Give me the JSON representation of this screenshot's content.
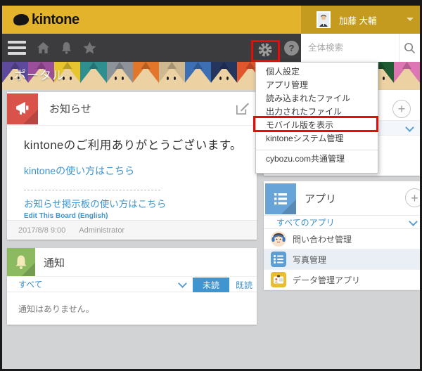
{
  "header": {
    "logo_text": "kintone",
    "user_name": "加藤 大輔"
  },
  "toolbar": {
    "search_placeholder": "全体検索",
    "help_label": "?"
  },
  "banner": {
    "title": "ポータル",
    "pencil_colors": [
      "#5d4a9c",
      "#9b4f9b",
      "#e7c52f",
      "#2f8f8f",
      "#8e9399",
      "#e2762a",
      "#cdb88f",
      "#3d6fb4",
      "#24355e",
      "#e2562e",
      "#b93a93",
      "#cf3434",
      "#e9e4d8",
      "#49a04f",
      "#1f5c33",
      "#df76b4"
    ]
  },
  "gear_menu": {
    "items": [
      "個人設定",
      "アプリ管理",
      "読み込まれたファイル",
      "出力されたファイル",
      "モバイル版を表示",
      "kintoneシステム管理",
      "cybozu.com共通管理"
    ],
    "highlighted_item": "モバイル版を表示"
  },
  "announcement": {
    "title": "お知らせ",
    "greeting": "kintoneのご利用ありがとうございます。",
    "link1": "kintoneの使い方はこちら",
    "link2": "お知らせ掲示板の使い方はこちら",
    "link3": "Edit This Board (English)",
    "timestamp": "2017/8/8 9:00",
    "author": "Administrator"
  },
  "notifications": {
    "title": "通知",
    "filter_label": "すべて",
    "unread_label": "未読",
    "read_label": "既読",
    "empty_message": "通知はありません。"
  },
  "apps": {
    "title": "アプリ",
    "all_apps_label": "すべてのアプリ",
    "items": [
      {
        "name": "問い合わせ管理"
      },
      {
        "name": "写真管理"
      },
      {
        "name": "データ管理アプリ"
      }
    ]
  },
  "ui": {
    "plus": "+"
  },
  "colors": {
    "header_yellow": "#e3b32b",
    "user_area_gold": "#c49b1f",
    "toolbar_dark": "#3c3c3e",
    "link_blue": "#3d95d2",
    "unread_button_blue": "#4094d0",
    "announce_red": "#d9534b",
    "notify_green": "#8cba60",
    "apps_blue": "#68a4d8",
    "photo_app_blue": "#5d9fd4",
    "data_app_yellow": "#e8bd2f",
    "highlight_red": "#e60d09",
    "background_gray": "#d2d3d5"
  }
}
